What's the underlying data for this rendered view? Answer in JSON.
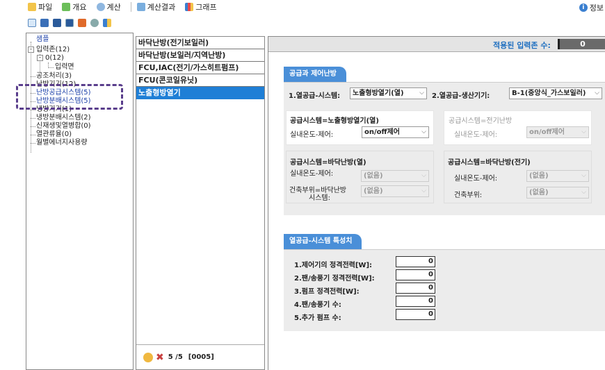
{
  "menu": {
    "file": "파일",
    "overview": "개요",
    "calculate": "계산",
    "results": "계산결과",
    "graph": "그래프",
    "info": "정보"
  },
  "tree": {
    "root": "샘플",
    "input_zone": "입력존(12)",
    "zone0": "0(12)",
    "input_surface": "입력면",
    "air_handling": "공조처리(3)",
    "heating_device": "난방기기(12)",
    "heating_supply": "난방공급시스템(5)",
    "heating_dist": "난방분배시스템(5)",
    "cooling_device": "냉방기기(1)",
    "cooling_dist": "냉방분배시스템(2)",
    "renewable": "신재생및열병합(0)",
    "heat_recovery": "열관류율(0)",
    "monthly_energy": "월별에너지사용량"
  },
  "list": {
    "items": [
      "바닥난방(전기보일러)",
      "바닥난방(보일러/지역난방)",
      "FCU,IAC(전기/가스히트펌프)",
      "FCU(콘코일유닛)",
      "노출형방열기"
    ],
    "selected_index": 4,
    "footer_count": "5 /5",
    "footer_code": "[0005]"
  },
  "main": {
    "applied_label": "적용된 입력존 수:",
    "applied_value": "0",
    "section1_tab": "공급과 제어난방",
    "supply_system_label": "1.열공급-시스템:",
    "supply_system_value": "노출형방열기(열)",
    "producer_label": "2.열공급-생산기기:",
    "producer_value": "B-1(중앙식_가스보일러)",
    "box_a": {
      "title": "공급시스템=노출형방열기(열)",
      "control_label": "실내온도-제어:",
      "control_value": "on/off제어"
    },
    "box_b": {
      "title": "공급시스템=전기난방",
      "control_label": "실내온도-제어:",
      "control_value": "on/off제어"
    },
    "box_c": {
      "title": "공급시스템=바닥난방(열)",
      "control_label": "실내온도-제어:",
      "control_value": "(없음)",
      "part_label_1": "건축부위=바닥난방",
      "part_label_2": "시스템:",
      "part_value": "(없음)"
    },
    "box_d": {
      "title": "공급시스템=바닥난방(전기)",
      "control_label": "실내온도-제어:",
      "control_value": "(없음)",
      "part_label": "건축부위:",
      "part_value": "(없음)"
    },
    "section2_tab": "열공급-시스템 특성치",
    "fields": [
      {
        "label": "1.제어기의 정격전력[W]:",
        "value": "0"
      },
      {
        "label": "2.팬/송풍기 정격전력[W]:",
        "value": "0"
      },
      {
        "label": "3.펌프 정격전력[W]:",
        "value": "0"
      },
      {
        "label": "4.팬/송풍기 수:",
        "value": "0"
      },
      {
        "label": "5.추가 펌프 수:",
        "value": "0"
      }
    ]
  },
  "colors": {
    "accent_blue": "#1f7fd6",
    "tab_blue": "#4a8fd8",
    "highlight_purple": "#5a3e8c"
  }
}
